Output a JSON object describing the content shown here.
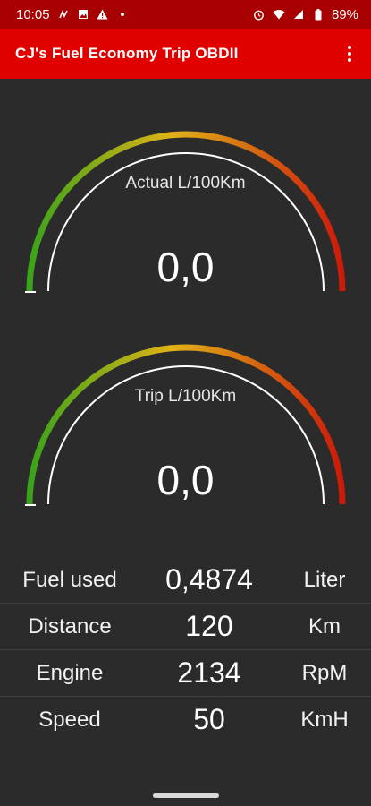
{
  "status_bar": {
    "time": "10:05",
    "battery": "89%",
    "icons": [
      "signal-alt-icon",
      "image-icon",
      "warning-icon",
      "dot-icon",
      "alarm-icon",
      "wifi-icon",
      "cell-signal-icon",
      "battery-icon"
    ]
  },
  "app_bar": {
    "title": "CJ's Fuel Economy Trip OBDII",
    "menu_icon": "more-vert-icon"
  },
  "gauges": [
    {
      "label": "Actual L/100Km",
      "value": "0,0",
      "level": 0
    },
    {
      "label": "Trip   L/100Km",
      "value": "0,0",
      "level": 0
    }
  ],
  "gauge_colors": {
    "start": "#3aa31a",
    "mid": "#e0b014",
    "end": "#cc1a0a"
  },
  "stats": [
    {
      "label": "Fuel used",
      "value": "0,4874",
      "unit": "Liter"
    },
    {
      "label": "Distance",
      "value": "120",
      "unit": "Km"
    },
    {
      "label": "Engine",
      "value": "2134",
      "unit": "RpM"
    },
    {
      "label": "Speed",
      "value": "50",
      "unit": "KmH"
    }
  ]
}
